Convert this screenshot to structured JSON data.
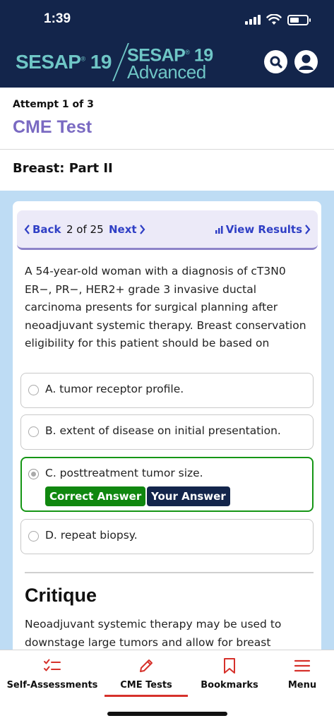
{
  "status_bar": {
    "time": "1:39"
  },
  "header": {
    "logo_main": "SESAP",
    "logo_main_sup": "®",
    "logo_main_num": " 19",
    "logo_adv_line1": "SESAP",
    "logo_adv_sup": "®",
    "logo_adv_num": " 19",
    "logo_adv_line2": "Advanced",
    "search_icon": "search-icon",
    "user_icon": "user-icon"
  },
  "test": {
    "attempt": "Attempt 1 of 3",
    "title": "CME Test",
    "section": "Breast: Part II"
  },
  "navigation": {
    "back_label": "Back",
    "position": "2 of 25",
    "next_label": "Next",
    "results_label": "View Results"
  },
  "question": {
    "text": "A 54-year-old woman with a diagnosis of cT3N0 ER−, PR−, HER2+ grade 3 invasive ductal carcinoma presents for surgical planning after neoadjuvant systemic therapy. Breast conservation eligibility for this patient should be based on",
    "options": [
      {
        "label": "A. tumor receptor profile.",
        "selected": false
      },
      {
        "label": "B. extent of disease on initial presentation.",
        "selected": false
      },
      {
        "label": "C. posttreatment tumor size.",
        "selected": true
      },
      {
        "label": "D. repeat biopsy.",
        "selected": false
      }
    ],
    "correct_badge": "Correct Answer",
    "your_badge": "Your Answer"
  },
  "critique": {
    "title": "Critique",
    "text": "Neoadjuvant systemic therapy may be used to downstage large tumors and allow for breast"
  },
  "tabs": [
    {
      "label": "Self-Assessments",
      "icon": "checklist-icon"
    },
    {
      "label": "CME Tests",
      "icon": "pencil-icon",
      "active": true
    },
    {
      "label": "Bookmarks",
      "icon": "bookmark-icon"
    },
    {
      "label": "Menu",
      "icon": "hamburger-menu-icon"
    }
  ],
  "colors": {
    "header_bg": "#13254b",
    "accent_teal": "#6fc6c6",
    "title_purple": "#7a6ac2",
    "link_blue": "#2f3fc5",
    "correct_green": "#10870f",
    "tab_red": "#d6312b",
    "content_bg": "#bedcf4"
  }
}
